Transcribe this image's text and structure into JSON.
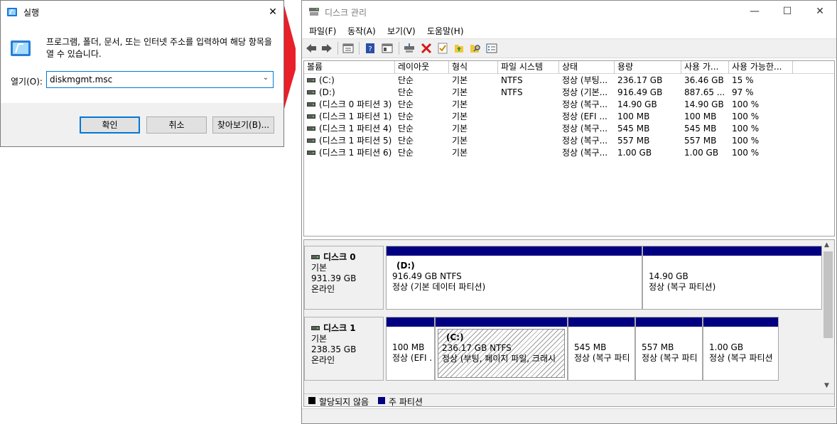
{
  "run_dialog": {
    "title": "실행",
    "description": "프로그램, 폴더, 문서, 또는 인터넷 주소를 입력하여 해당 항목을 열 수 있습니다.",
    "open_label": "열기(O):",
    "input_value": "diskmgmt.msc",
    "ok_label": "확인",
    "cancel_label": "취소",
    "browse_label": "찾아보기(B)..."
  },
  "disk_mgmt": {
    "title": "디스크 관리",
    "menu": [
      "파일(F)",
      "동작(A)",
      "보기(V)",
      "도움말(H)"
    ],
    "columns": [
      "볼륨",
      "레이아웃",
      "형식",
      "파일 시스템",
      "상태",
      "용량",
      "사용 가...",
      "사용 가능한..."
    ],
    "rows": [
      [
        "(C:)",
        "단순",
        "기본",
        "NTFS",
        "정상 (부팅...",
        "236.17 GB",
        "36.46 GB",
        "15 %"
      ],
      [
        "(D:)",
        "단순",
        "기본",
        "NTFS",
        "정상 (기본...",
        "916.49 GB",
        "887.65 ...",
        "97 %"
      ],
      [
        "(디스크 0 파티션 3)",
        "단순",
        "기본",
        "",
        "정상 (복구...",
        "14.90 GB",
        "14.90 GB",
        "100 %"
      ],
      [
        "(디스크 1 파티션 1)",
        "단순",
        "기본",
        "",
        "정상 (EFI ...",
        "100 MB",
        "100 MB",
        "100 %"
      ],
      [
        "(디스크 1 파티션 4)",
        "단순",
        "기본",
        "",
        "정상 (복구...",
        "545 MB",
        "545 MB",
        "100 %"
      ],
      [
        "(디스크 1 파티션 5)",
        "단순",
        "기본",
        "",
        "정상 (복구...",
        "557 MB",
        "557 MB",
        "100 %"
      ],
      [
        "(디스크 1 파티션 6)",
        "단순",
        "기본",
        "",
        "정상 (복구...",
        "1.00 GB",
        "1.00 GB",
        "100 %"
      ]
    ],
    "disks": [
      {
        "name": "디스크 0",
        "type": "기본",
        "size": "931.39 GB",
        "status": "온라인",
        "partitions": [
          {
            "name": "(D:)",
            "size": "916.49 GB NTFS",
            "status": "정상 (기본 데이터 파티션)",
            "hatched": false
          },
          {
            "name": "",
            "size": "14.90 GB",
            "status": "정상 (복구 파티션)",
            "hatched": false
          }
        ]
      },
      {
        "name": "디스크 1",
        "type": "기본",
        "size": "238.35 GB",
        "status": "온라인",
        "partitions": [
          {
            "name": "",
            "size": "100 MB",
            "status": "정상 (EFI ...",
            "hatched": false
          },
          {
            "name": "(C:)",
            "size": "236.17 GB NTFS",
            "status": "정상 (부팅, 페이지 파일, 크래시",
            "hatched": true
          },
          {
            "name": "",
            "size": "545 MB",
            "status": "정상 (복구 파티",
            "hatched": false
          },
          {
            "name": "",
            "size": "557 MB",
            "status": "정상 (복구 파티",
            "hatched": false
          },
          {
            "name": "",
            "size": "1.00 GB",
            "status": "정상 (복구 파티션",
            "hatched": false
          }
        ]
      }
    ],
    "legend": [
      {
        "label": "할당되지 않음",
        "color": "#000000"
      },
      {
        "label": "주 파티션",
        "color": "#000080"
      }
    ]
  },
  "colors": {
    "primary_partition": "#000080",
    "unallocated": "#000000",
    "accent": "#0078d7"
  }
}
